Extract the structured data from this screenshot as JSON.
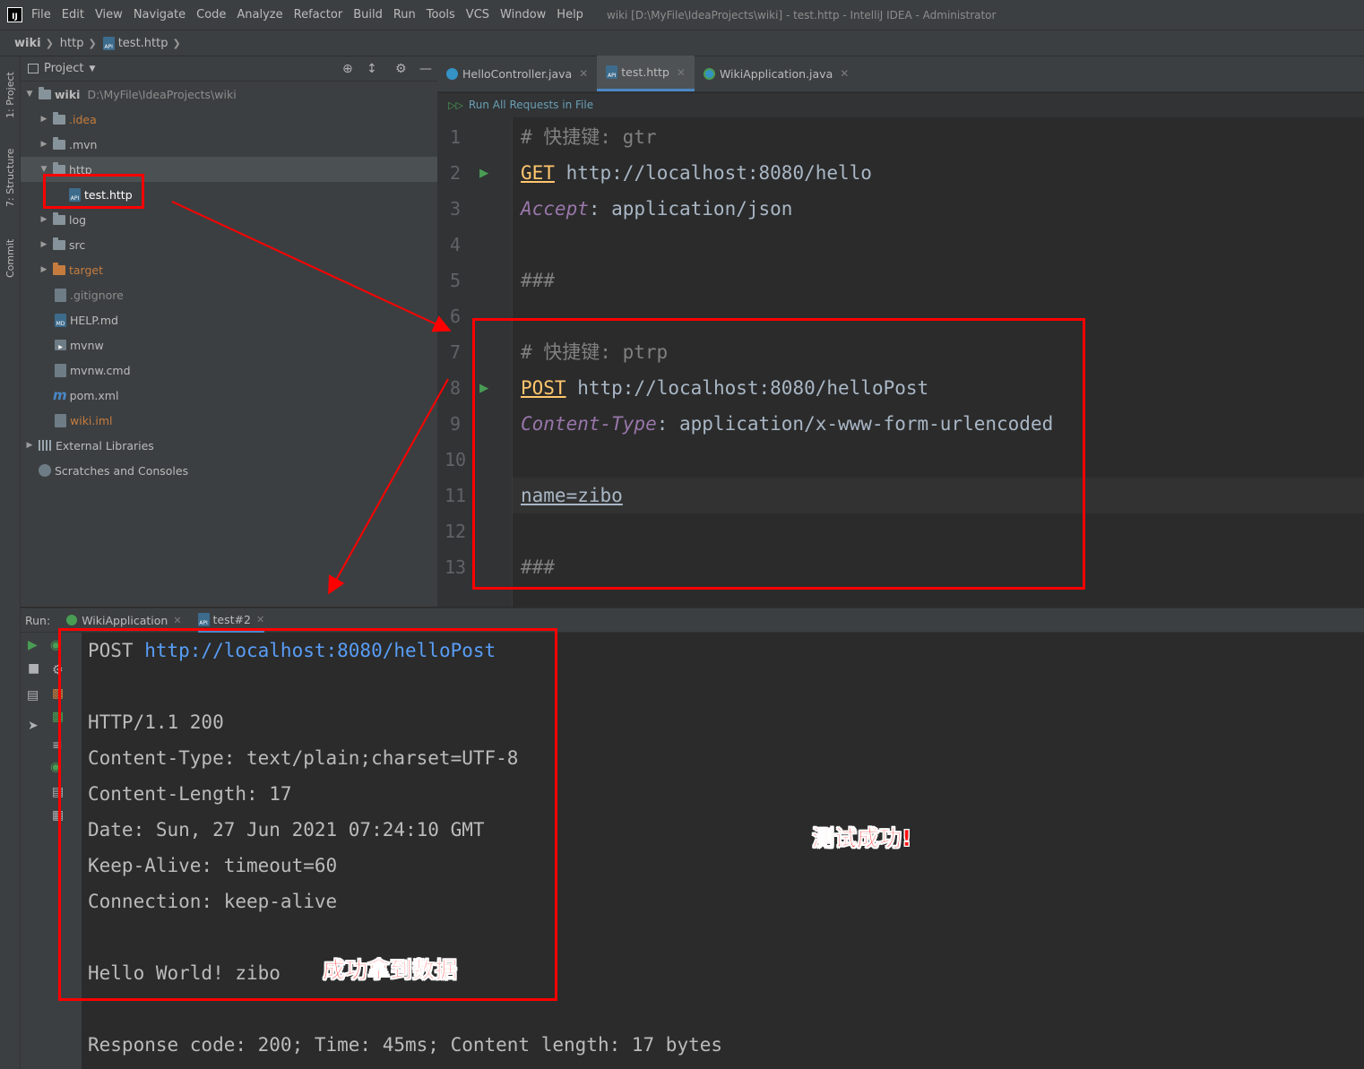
{
  "menubar": {
    "logo": "IJ",
    "items": [
      "File",
      "Edit",
      "View",
      "Navigate",
      "Code",
      "Analyze",
      "Refactor",
      "Build",
      "Run",
      "Tools",
      "VCS",
      "Window",
      "Help"
    ],
    "window_title": "wiki [D:\\MyFile\\IdeaProjects\\wiki] - test.http - IntelliJ IDEA - Administrator"
  },
  "breadcrumb": [
    "wiki",
    "http",
    "test.http"
  ],
  "left_strip": [
    "1: Project",
    "7: Structure",
    "Commit"
  ],
  "project": {
    "header": "Project",
    "tree": [
      {
        "label": "wiki",
        "extra": "D:\\MyFile\\IdeaProjects\\wiki"
      },
      {
        "label": ".idea"
      },
      {
        "label": ".mvn"
      },
      {
        "label": "http"
      },
      {
        "label": "test.http"
      },
      {
        "label": "log"
      },
      {
        "label": "src"
      },
      {
        "label": "target"
      },
      {
        "label": ".gitignore"
      },
      {
        "label": "HELP.md"
      },
      {
        "label": "mvnw"
      },
      {
        "label": "mvnw.cmd"
      },
      {
        "label": "pom.xml"
      },
      {
        "label": "wiki.iml"
      },
      {
        "label": "External Libraries"
      },
      {
        "label": "Scratches and Consoles"
      }
    ]
  },
  "editor": {
    "tabs": [
      "HelloController.java",
      "test.http",
      "WikiApplication.java"
    ],
    "run_all": "Run All Requests in File",
    "line_numbers": [
      "1",
      "2",
      "3",
      "4",
      "5",
      "6",
      "7",
      "8",
      "9",
      "10",
      "11",
      "12",
      "13"
    ],
    "lines": {
      "l1": "# 快捷键: gtr",
      "l2_method": "GET",
      "l2_url": " http://localhost:8080/hello",
      "l3_header": "Accept",
      "l3_value": ": application/json",
      "l5": "###",
      "l7": "# 快捷键: ptrp",
      "l8_method": "POST",
      "l8_url": " http://localhost:8080/helloPost",
      "l9_header": "Content-Type",
      "l9_value": ": application/x-www-form-urlencoded",
      "l11": "name=zibo",
      "l13": "###"
    }
  },
  "run": {
    "label": "Run:",
    "tabs": [
      "WikiApplication",
      "test#2"
    ],
    "console": {
      "request_method": "POST ",
      "request_url": "http://localhost:8080/helloPost",
      "status": "HTTP/1.1 200",
      "h1": "Content-Type: text/plain;charset=UTF-8",
      "h2": "Content-Length: 17",
      "h3": "Date: Sun, 27 Jun 2021 07:24:10 GMT",
      "h4": "Keep-Alive: timeout=60",
      "h5": "Connection: keep-alive",
      "body": "Hello World! zibo",
      "summary": "Response code: 200; Time: 45ms; Content length: 17 bytes"
    }
  },
  "annotations": {
    "success_test": "测试成功!",
    "success_data": "成功拿到数据"
  },
  "colors": {
    "highlight_box": "#ff0000",
    "run_green": "#499c54",
    "link_blue": "#589df6"
  }
}
